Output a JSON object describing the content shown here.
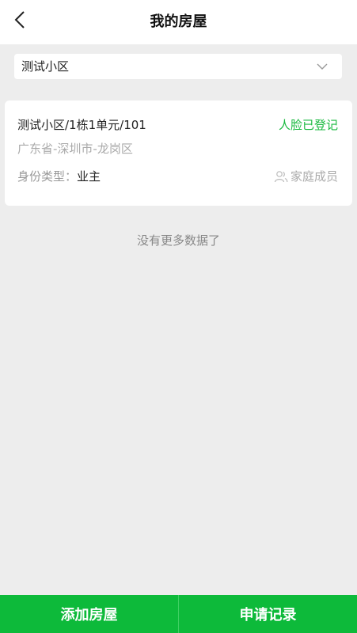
{
  "header": {
    "title": "我的房屋",
    "back_icon": "chevron-left-icon"
  },
  "community_select": {
    "value": "测试小区",
    "icon": "chevron-down-icon"
  },
  "house_card": {
    "address": "测试小区/1栋1单元/101",
    "face_status": "人脸已登记",
    "region": "广东省-深圳市-龙岗区",
    "identity_label": "身份类型：",
    "identity_value": "业主",
    "family_members_label": "家庭成员",
    "family_icon": "user-group-icon"
  },
  "list_footer": "没有更多数据了",
  "bottom_bar": {
    "add_label": "添加房屋",
    "records_label": "申请记录"
  },
  "colors": {
    "primary_green": "#0dba3a",
    "status_green": "#19b93f",
    "background": "#ededed"
  }
}
